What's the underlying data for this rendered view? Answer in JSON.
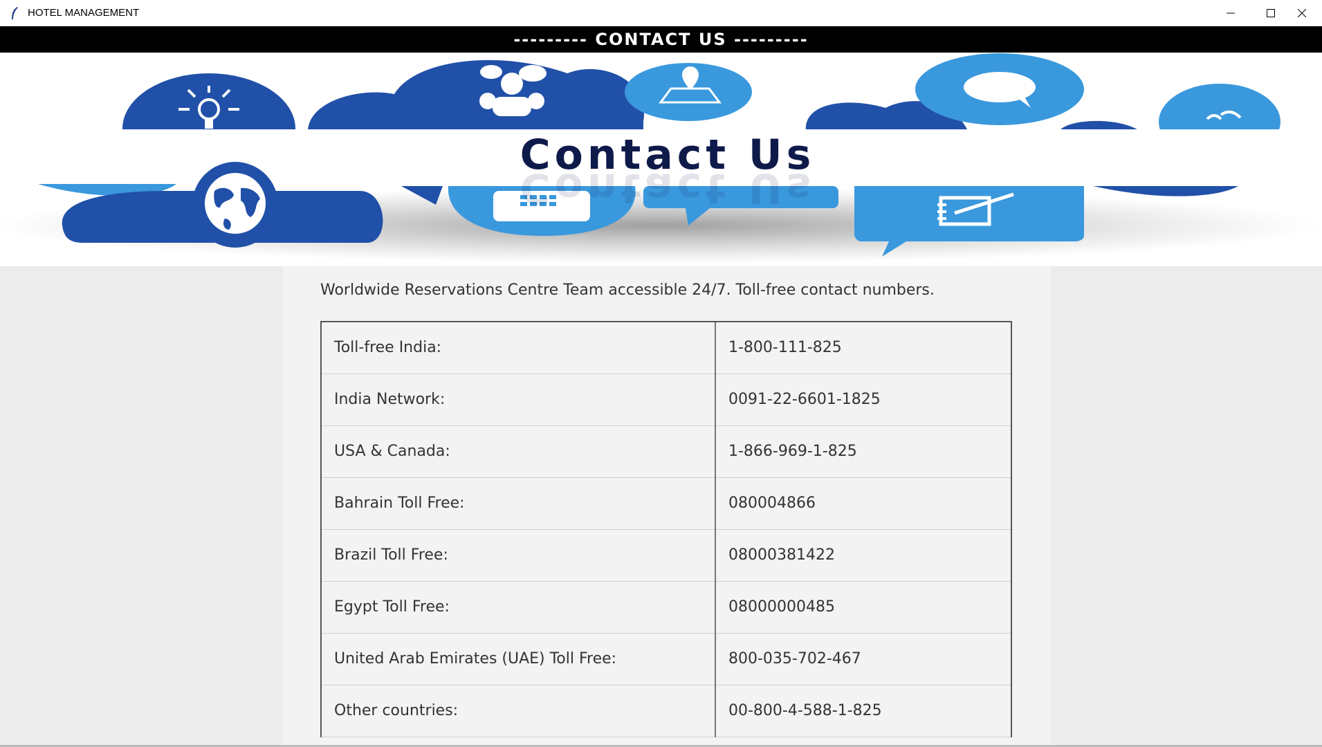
{
  "window": {
    "title": "HOTEL MANAGEMENT",
    "controls": [
      "minimize-icon",
      "maximize-icon",
      "close-icon"
    ]
  },
  "header": {
    "title": "--------- CONTACT US ---------"
  },
  "banner": {
    "heading": "Contact Us",
    "icons": [
      "lightbulb-icon",
      "people-chat-icon",
      "map-pin-icon",
      "speech-bubble-icon",
      "phone-call-icon",
      "globe-icon",
      "telephone-icon",
      "notepad-icon"
    ]
  },
  "main": {
    "intro": "Worldwide Reservations Centre Team accessible 24/7. Toll-free contact numbers.",
    "rows": [
      {
        "label": "Toll-free India:",
        "number": "1-800-111-825"
      },
      {
        "label": "India Network:",
        "number": "0091-22-6601-1825"
      },
      {
        "label": "USA & Canada:",
        "number": "1-866-969-1-825"
      },
      {
        "label": "Bahrain Toll Free:",
        "number": "080004866"
      },
      {
        "label": "Brazil Toll Free:",
        "number": "08000381422"
      },
      {
        "label": "Egypt Toll Free:",
        "number": "08000000485"
      },
      {
        "label": "United Arab Emirates (UAE) Toll Free:",
        "number": "800-035-702-467"
      },
      {
        "label": "Other countries:",
        "number": "00-800-4-588-1-825"
      }
    ]
  },
  "colors": {
    "dark_blue": "#2150a8",
    "light_blue": "#3a98dd",
    "heading_navy": "#0e1a4a",
    "header_bg": "#000000"
  }
}
